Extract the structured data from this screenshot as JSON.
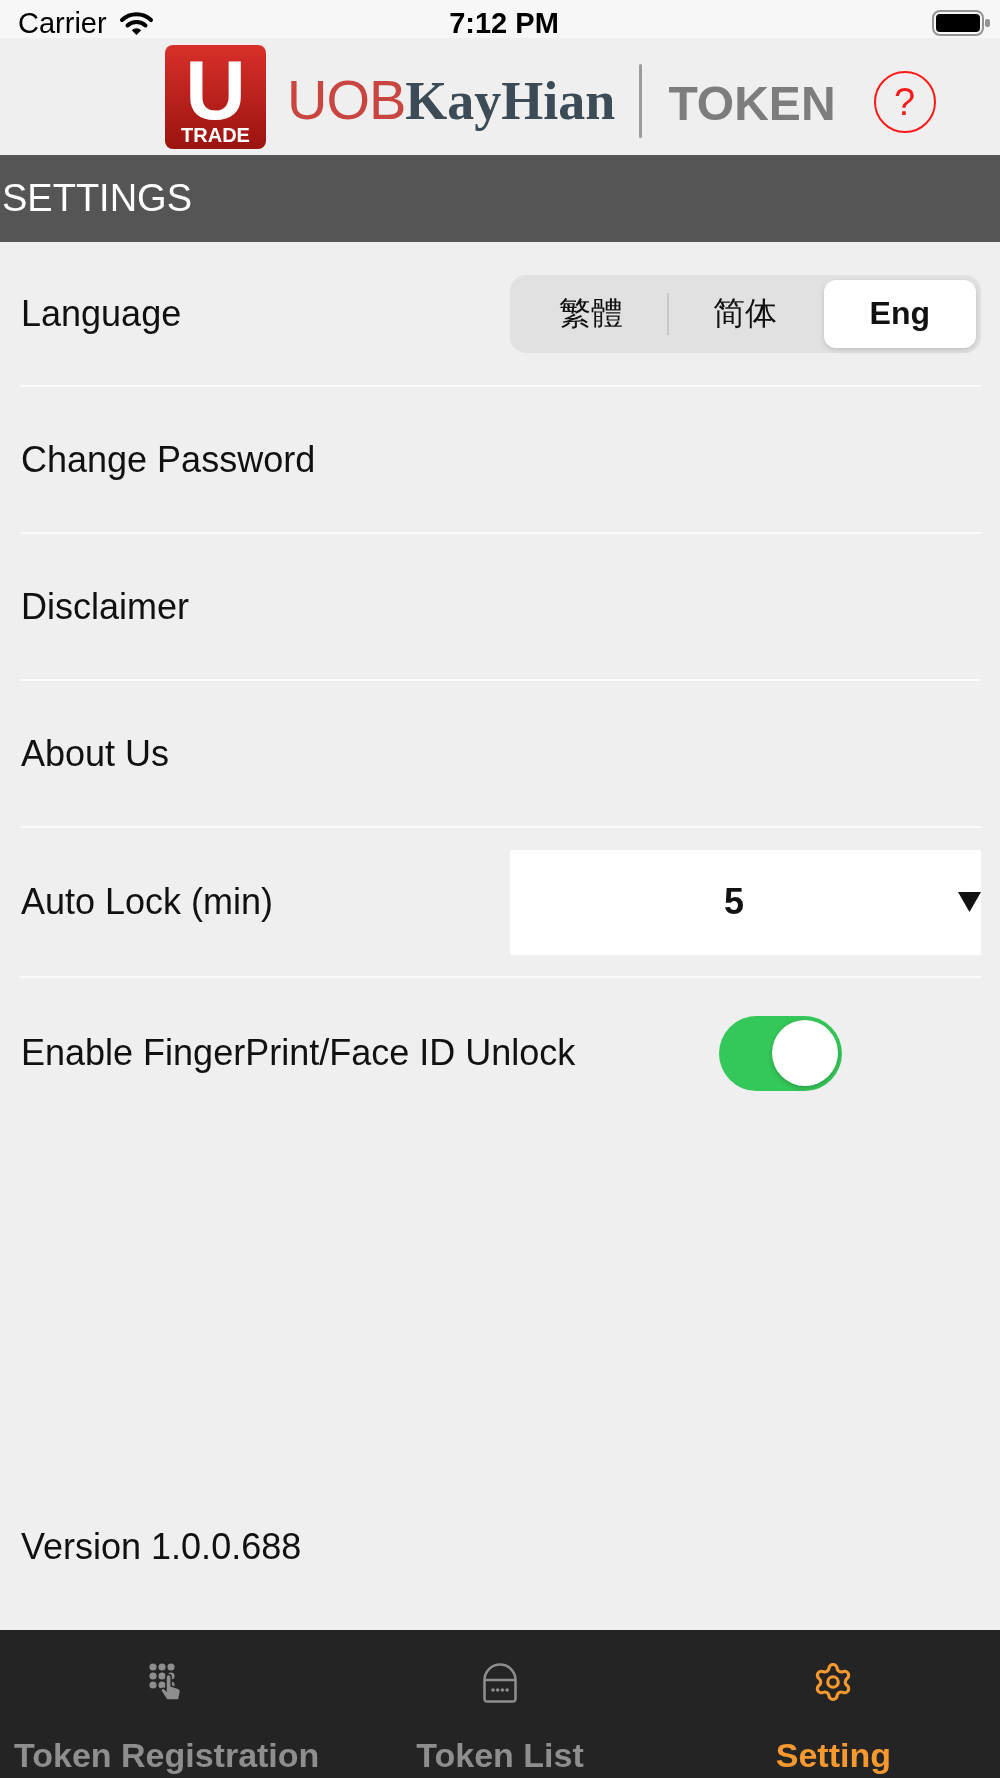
{
  "status_bar": {
    "carrier": "Carrier",
    "time": "7:12 PM"
  },
  "header": {
    "logo": {
      "badge_letter": "U",
      "badge_word": "TRADE",
      "brand_first": "UOB",
      "brand_second": "KayHian",
      "product": "TOKEN"
    },
    "help_button": {
      "label": "?"
    }
  },
  "section_title": "SETTINGS",
  "settings": [
    {
      "kind": "segmented",
      "label": "Language",
      "options": [
        {
          "label": "繁體",
          "selected": false
        },
        {
          "label": "简体",
          "selected": false
        },
        {
          "label": "Eng",
          "selected": true
        }
      ]
    },
    {
      "kind": "link",
      "label": "Change Password"
    },
    {
      "kind": "link",
      "label": "Disclaimer"
    },
    {
      "kind": "link",
      "label": "About Us"
    },
    {
      "kind": "dropdown",
      "label": "Auto Lock (min)",
      "value": "5"
    },
    {
      "kind": "toggle",
      "label": "Enable FingerPrint/Face ID Unlock",
      "on": true
    }
  ],
  "version": "Version 1.0.0.688",
  "tab_bar": [
    {
      "label": "Token Registration",
      "selected": false
    },
    {
      "label": "Token List",
      "selected": false
    },
    {
      "label": "Setting",
      "selected": true
    }
  ]
}
